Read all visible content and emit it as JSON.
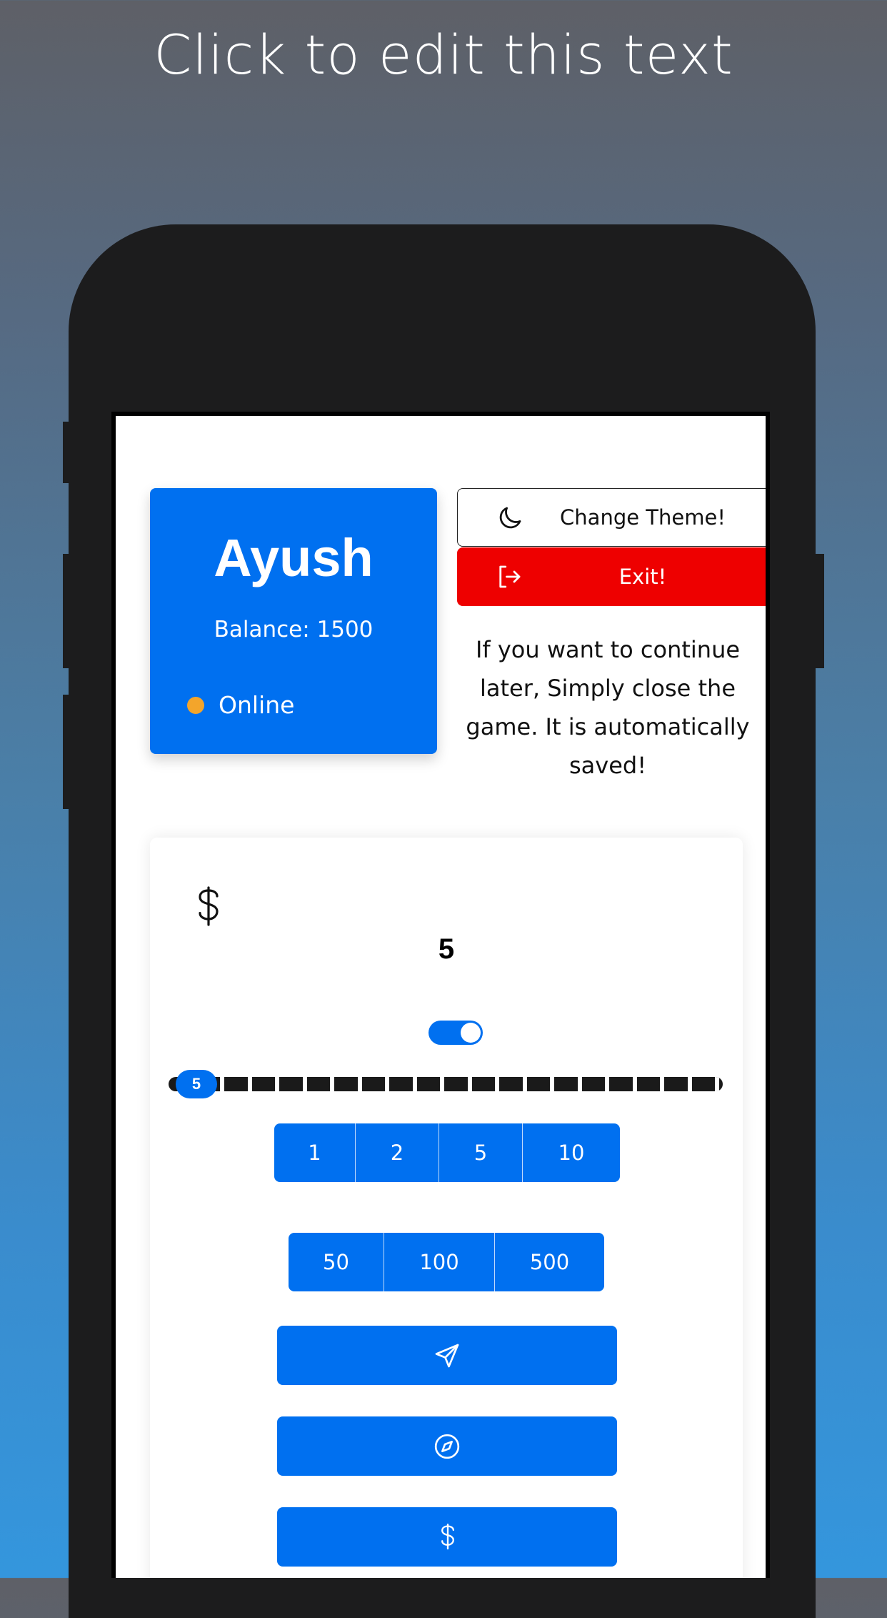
{
  "banner": {
    "text": "Click to edit this text"
  },
  "player": {
    "name": "Ayush",
    "balance": "Balance: 1500",
    "status": "Online",
    "status_color": "#f3a52b"
  },
  "buttons": {
    "theme": {
      "label": "Change Theme!",
      "icon": "moon-icon"
    },
    "exit": {
      "label": "Exit!",
      "icon": "logout-icon"
    }
  },
  "note": "If you want to continue later, Simply close the game. It is automatically saved!",
  "bet": {
    "currency_icon": "dollar-icon",
    "amount": "5",
    "toggle_on": true,
    "slider_value": "5",
    "quick_amounts_row1": [
      "1",
      "2",
      "5",
      "10"
    ],
    "quick_amounts_row2": [
      "50",
      "100",
      "500"
    ],
    "actions": [
      {
        "icon": "send-icon"
      },
      {
        "icon": "compass-icon"
      },
      {
        "icon": "dollar-icon"
      }
    ]
  },
  "colors": {
    "accent": "#0070f0",
    "danger": "#ee0000",
    "screen": "#ffffff",
    "phone": "#1c1c1d"
  }
}
